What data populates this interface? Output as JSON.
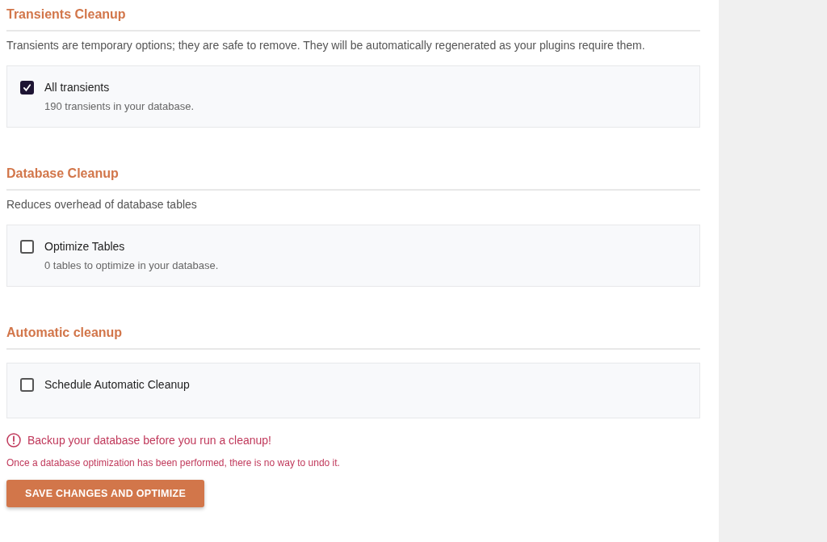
{
  "sections": [
    {
      "title": "Transients Cleanup",
      "description": "Transients are temporary options; they are safe to remove. They will be automatically regenerated as your plugins require them.",
      "options": [
        {
          "label": "All transients",
          "detail": "190 transients in your database.",
          "checked": true
        }
      ]
    },
    {
      "title": "Database Cleanup",
      "description": "Reduces overhead of database tables",
      "options": [
        {
          "label": "Optimize Tables",
          "detail": "0 tables to optimize in your database.",
          "checked": false
        }
      ]
    },
    {
      "title": "Automatic cleanup",
      "options": [
        {
          "label": "Schedule Automatic Cleanup",
          "checked": false
        }
      ]
    }
  ],
  "warning": "Backup your database before you run a cleanup!",
  "note": "Once a database optimization has been performed, there is no way to undo it.",
  "button": "SAVE CHANGES AND OPTIMIZE"
}
